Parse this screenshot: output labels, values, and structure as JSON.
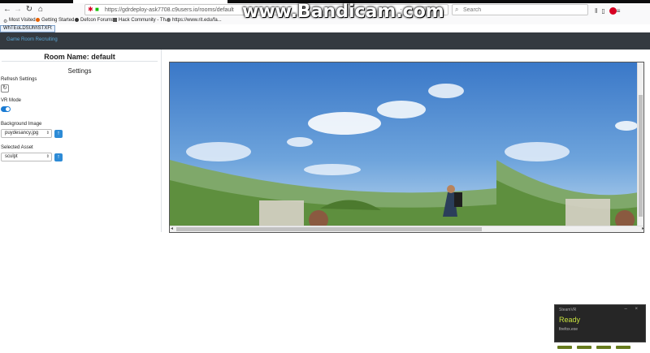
{
  "browser": {
    "url": "https://gdrdeploy-ask7708.c9users.io/rooms/default",
    "search_placeholder": "Search",
    "bookmarks": [
      {
        "label": "Most Visited"
      },
      {
        "label": "Getting Started"
      },
      {
        "label": "Defcon Forums"
      },
      {
        "label": "Hack Community - Th..."
      },
      {
        "label": "https://www.rit.edu/fa..."
      }
    ],
    "tooltip": "WhTEoLDSUhhSTXFt"
  },
  "watermark": "www.Bandicam.com",
  "app": {
    "brand": "Game Room Recruiting"
  },
  "sidebar": {
    "room_name": "Room Name: default",
    "settings_title": "Settings",
    "refresh_label": "Refresh Settings",
    "vr_label": "VR Mode",
    "vr_enabled": true,
    "background_label": "Background Image",
    "background_value": "puydesancy.jpg",
    "asset_label": "Selected Asset",
    "asset_value": "sculpt"
  },
  "widget": {
    "title": "SteamVR",
    "status": "Ready",
    "app": "firefox.exe"
  },
  "colors": {
    "nav_bg": "#343a40",
    "brand": "#5aa7d6",
    "accent": "#2d8bd6",
    "ready": "#c8e23f"
  }
}
